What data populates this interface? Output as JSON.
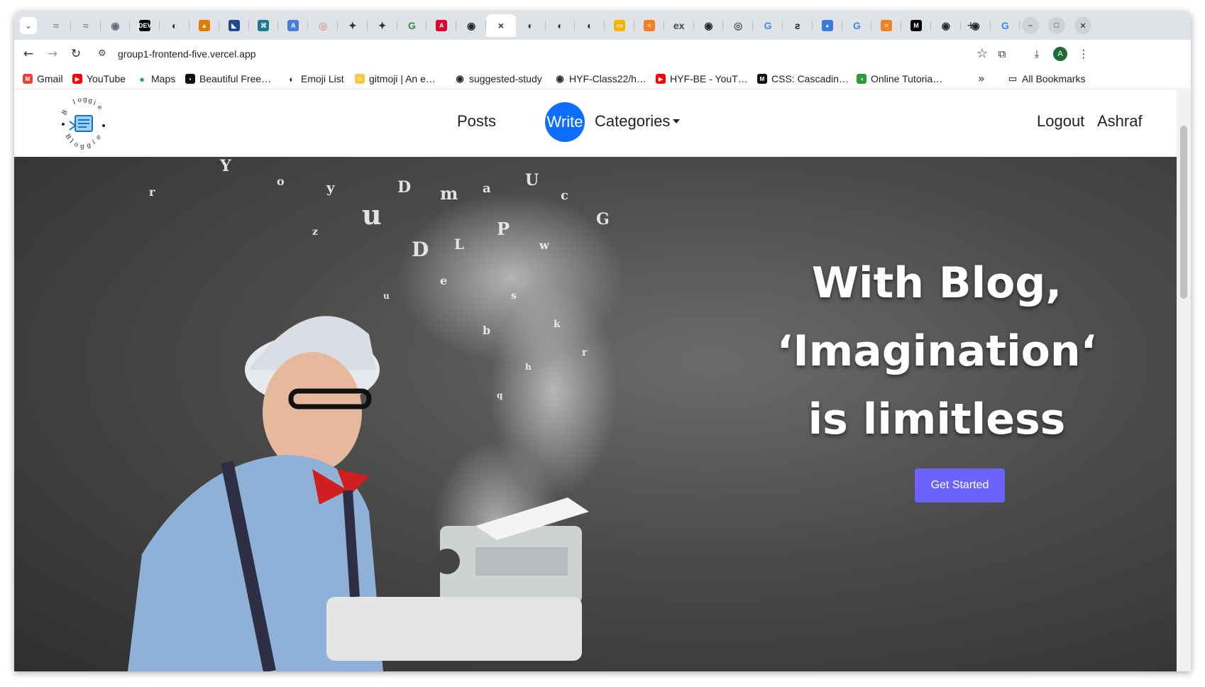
{
  "browser": {
    "tabs": [
      {
        "icon": "tab-icon-1",
        "color": "#8a8fa8",
        "glyph": "≈"
      },
      {
        "icon": "tab-icon-2",
        "color": "#8a8fa8",
        "glyph": "≈"
      },
      {
        "icon": "globe-icon",
        "color": "#5a6e7f",
        "glyph": "◉"
      },
      {
        "icon": "dev-icon",
        "color": "#000000",
        "glyph": "DEV"
      },
      {
        "icon": "site-icon",
        "color": "#333333",
        "glyph": "◐"
      },
      {
        "icon": "chart-icon",
        "color": "#e07b00",
        "glyph": "▲"
      },
      {
        "icon": "app-icon",
        "color": "#1e4a8a",
        "glyph": "◣"
      },
      {
        "icon": "code-icon",
        "color": "#1b7a8e",
        "glyph": "⌘"
      },
      {
        "icon": "translate-icon",
        "color": "#4a7de0",
        "glyph": "A"
      },
      {
        "icon": "circle-icon",
        "color": "#d9a0a0",
        "glyph": "◎"
      },
      {
        "icon": "openai-icon",
        "color": "#333333",
        "glyph": "✦"
      },
      {
        "icon": "openai-icon-2",
        "color": "#333333",
        "glyph": "✦"
      },
      {
        "icon": "gfg-icon",
        "color": "#2f8d46",
        "glyph": "G"
      },
      {
        "icon": "angular-icon",
        "color": "#dd0031",
        "glyph": "A"
      },
      {
        "icon": "github-icon",
        "color": "#24292f",
        "glyph": "◉"
      },
      {
        "icon": "active-tab-close-icon",
        "color": "#333333",
        "glyph": "×",
        "active": true
      },
      {
        "icon": "site-icon-2",
        "color": "#333333",
        "glyph": "◐"
      },
      {
        "icon": "site-icon-3",
        "color": "#333333",
        "glyph": "◐"
      },
      {
        "icon": "site-icon-4",
        "color": "#333333",
        "glyph": "◐"
      },
      {
        "icon": "slides-icon",
        "color": "#f4b400",
        "glyph": "▭"
      },
      {
        "icon": "stackoverflow-icon",
        "color": "#f48024",
        "glyph": "≡"
      },
      {
        "icon": "ex-icon",
        "color": "#444444",
        "glyph": "ex"
      },
      {
        "icon": "github-icon-2",
        "color": "#24292f",
        "glyph": "◉"
      },
      {
        "icon": "chrome-icon",
        "color": "#555555",
        "glyph": "◎"
      },
      {
        "icon": "google-icon",
        "color": "#4285f4",
        "glyph": "G"
      },
      {
        "icon": "swirl-icon",
        "color": "#222222",
        "glyph": "ƨ"
      },
      {
        "icon": "copilot-icon",
        "color": "#3a7bd5",
        "glyph": "◕"
      },
      {
        "icon": "google-icon-2",
        "color": "#4285f4",
        "glyph": "G"
      },
      {
        "icon": "stackoverflow-icon-2",
        "color": "#f48024",
        "glyph": "≡"
      },
      {
        "icon": "medium-icon",
        "color": "#000000",
        "glyph": "M"
      },
      {
        "icon": "github-icon-3",
        "color": "#24292f",
        "glyph": "◉"
      },
      {
        "icon": "github-icon-4",
        "color": "#24292f",
        "glyph": "◉"
      },
      {
        "icon": "google-icon-3",
        "color": "#4285f4",
        "glyph": "G"
      },
      {
        "icon": "record-icon",
        "color": "#e53935",
        "glyph": "◉"
      }
    ],
    "url": "group1-frontend-five.vercel.app",
    "profile_initial": "A",
    "bookmarks": [
      {
        "label": "Gmail",
        "icon": "gmail-icon",
        "color": "#ea4335",
        "glyph": "M"
      },
      {
        "label": "YouTube",
        "icon": "youtube-icon",
        "color": "#ff0000",
        "glyph": "▶"
      },
      {
        "label": "Maps",
        "icon": "maps-icon",
        "color": "#34a853",
        "glyph": "●"
      },
      {
        "label": "Beautiful Free…",
        "icon": "unsplash-icon",
        "color": "#111111",
        "glyph": "▪"
      },
      {
        "label": "Emoji List",
        "icon": "globe-icon",
        "color": "#333333",
        "glyph": "◐"
      },
      {
        "label": "gitmoji | An e…",
        "icon": "gitmoji-icon",
        "color": "#f7c948",
        "glyph": "☺"
      },
      {
        "label": "suggested-study",
        "icon": "github-icon",
        "color": "#24292f",
        "glyph": "◉"
      },
      {
        "label": "HYF-Class22/h…",
        "icon": "github-icon",
        "color": "#24292f",
        "glyph": "◉"
      },
      {
        "label": "HYF-BE - YouT…",
        "icon": "youtube-icon",
        "color": "#ff0000",
        "glyph": "▶"
      },
      {
        "label": "CSS: Cascadin…",
        "icon": "mdn-icon",
        "color": "#111111",
        "glyph": "M"
      },
      {
        "label": "Online Tutoria…",
        "icon": "tutorial-icon",
        "color": "#2e9a3e",
        "glyph": "◑"
      },
      {
        "label": "All Bookmarks",
        "icon": "folder-icon",
        "color": "#555555",
        "glyph": "▭"
      }
    ]
  },
  "site": {
    "logo_text": "Bloggie Bloggie",
    "nav": {
      "posts": "Posts",
      "write": "Write",
      "categories": "Categories",
      "logout": "Logout",
      "user": "Ashraf"
    },
    "hero": {
      "line1": "With Blog,",
      "line2": "‘Imagination‘",
      "line3": "is limitless",
      "cta": "Get Started"
    },
    "colors": {
      "write_bg": "#0d6efd",
      "cta_bg": "#6c63ff"
    }
  }
}
